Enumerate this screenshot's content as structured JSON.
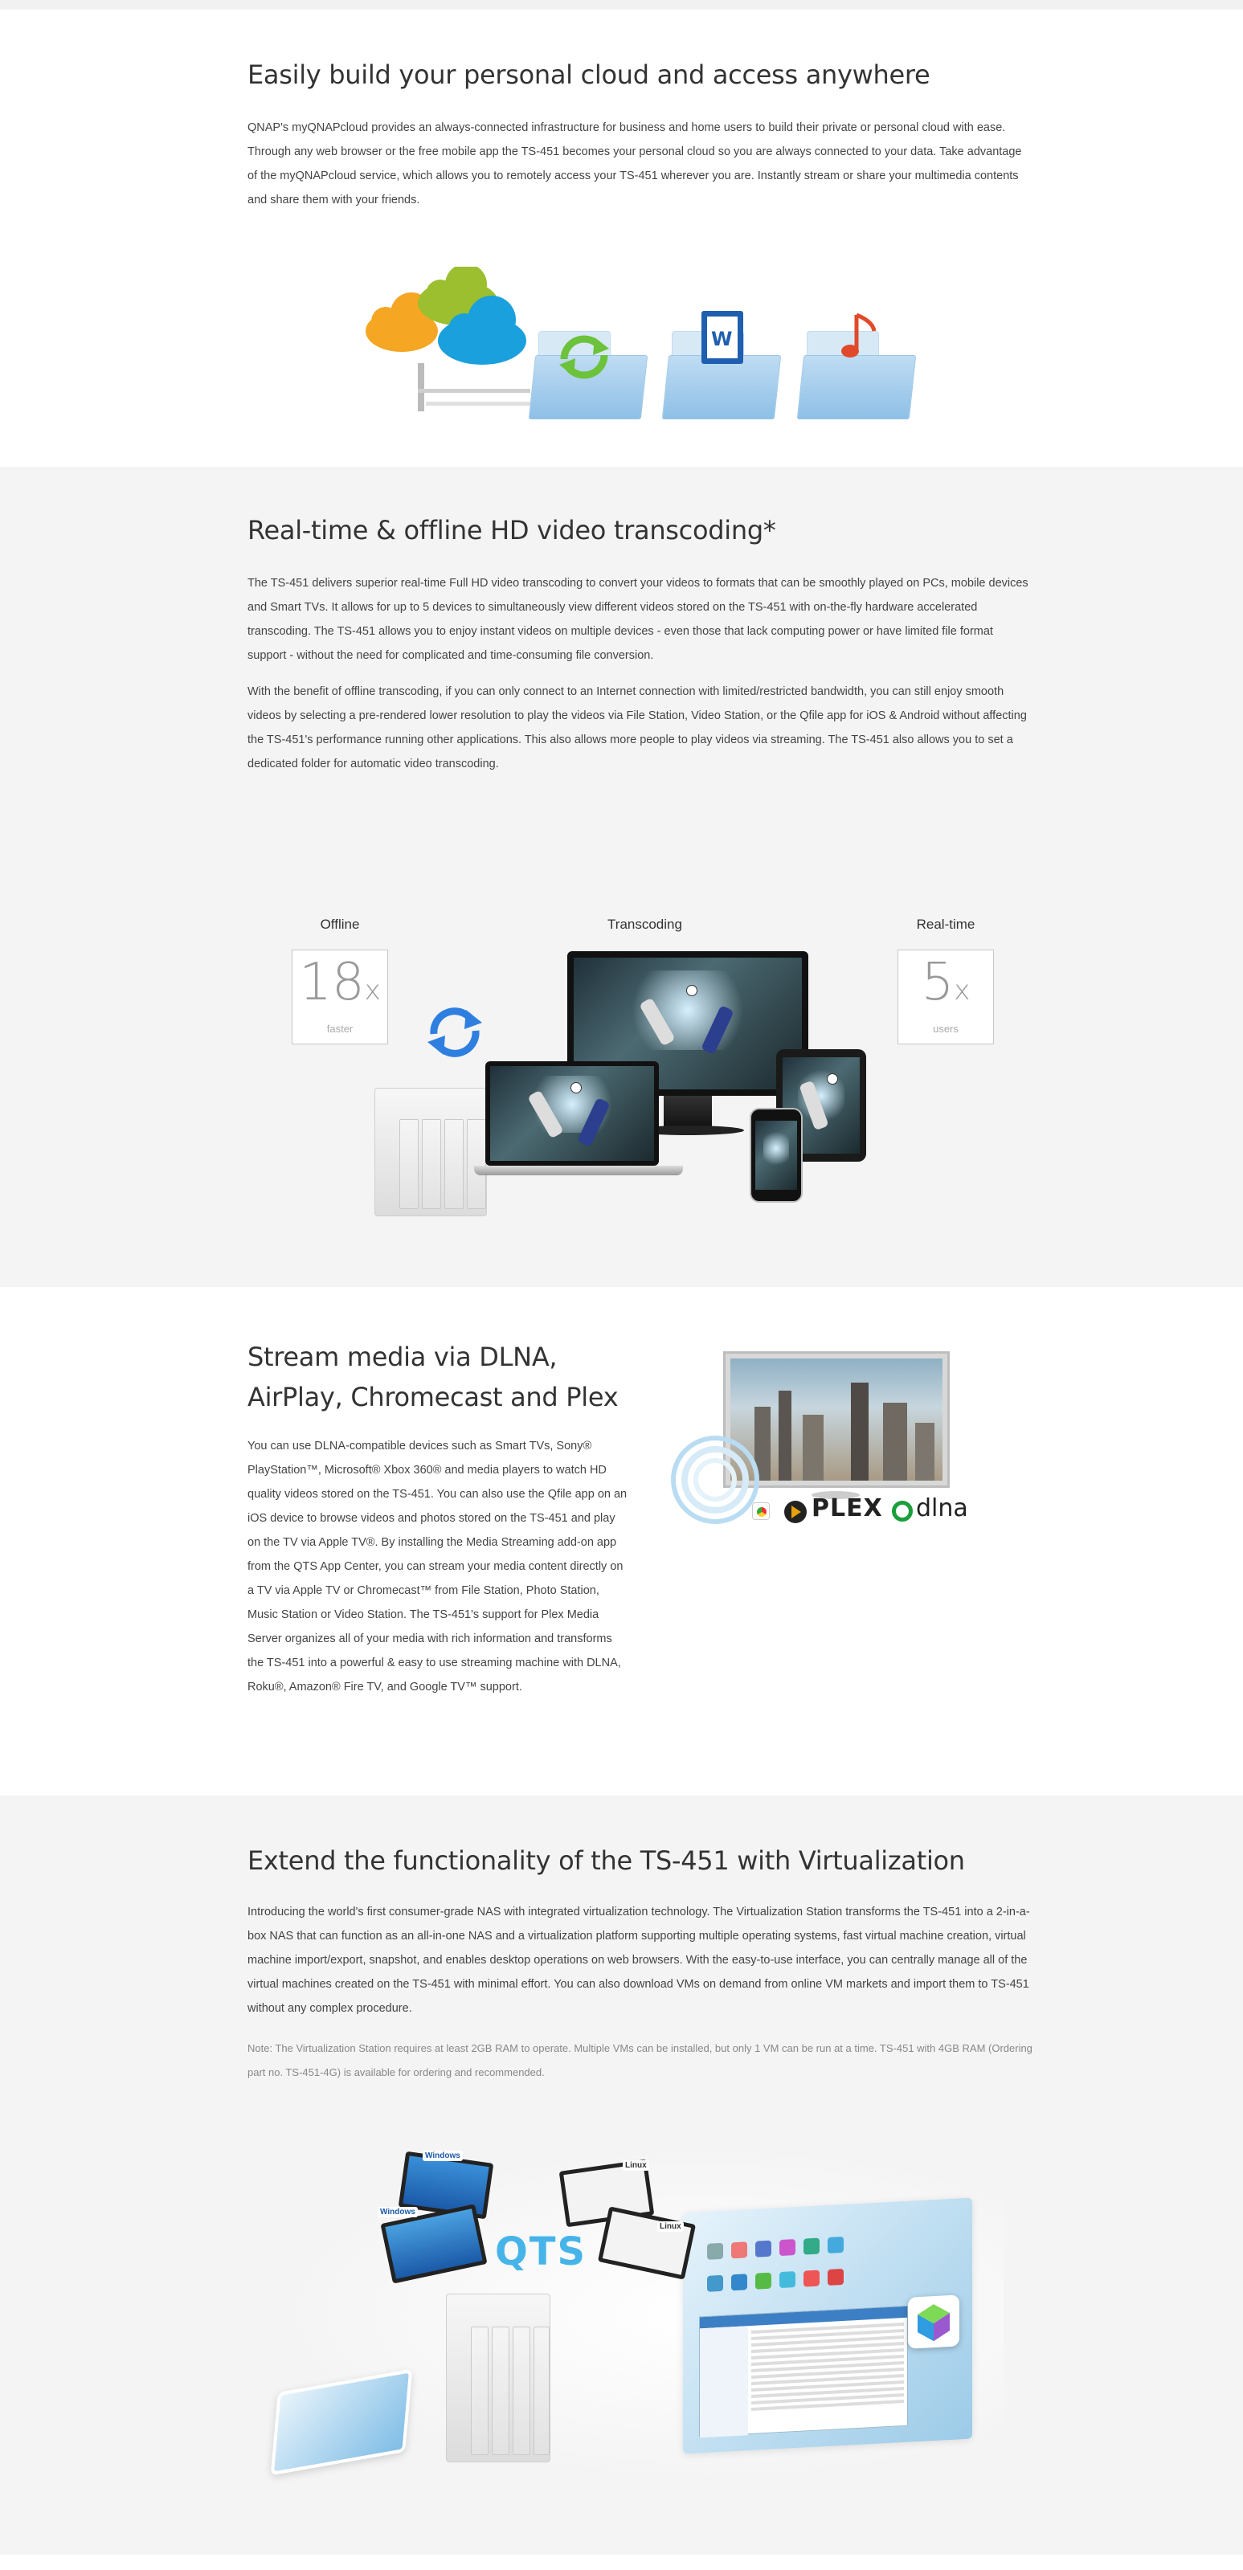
{
  "sections": {
    "cloud": {
      "title": "Easily build your personal cloud and access anywhere",
      "body": "QNAP's myQNAPcloud provides an always-connected infrastructure for business and home users to build their private or personal cloud with ease. Through any web browser or the free mobile app the TS-451 becomes your personal cloud so you are always connected to your data. Take advantage of the myQNAPcloud service, which allows you to remotely access your TS-451 wherever you are. Instantly stream or share your multimedia contents and share them with your friends."
    },
    "transcoding": {
      "title": "Real-time & offline HD video transcoding*",
      "body1": "The TS-451 delivers superior real-time Full HD video transcoding to convert your videos to formats that can be smoothly played on PCs, mobile devices and Smart TVs. It allows for up to 5 devices to simultaneously view different videos stored on the TS-451 with on-the-fly hardware accelerated transcoding. The TS-451 allows you to enjoy instant videos on multiple devices - even those that lack computing power or have limited file format support - without the need for complicated and time-consuming file conversion.",
      "body2": "With the benefit of offline transcoding, if you can only connect to an Internet connection with limited/restricted bandwidth, you can still enjoy smooth videos by selecting a pre-rendered lower resolution to play the videos via File Station, Video Station, or the Qfile app for iOS & Android without affecting the TS-451's performance running other applications. This also allows more people to play videos via streaming. The TS-451 also allows you to set a dedicated folder for automatic video transcoding.",
      "offline_label": "Offline",
      "offline_value": "18",
      "offline_unit": "x",
      "offline_sub": "faster",
      "transcoding_label": "Transcoding",
      "realtime_label": "Real-time",
      "realtime_value": "5",
      "realtime_unit": "x",
      "realtime_sub": "users"
    },
    "stream": {
      "title_line1": "Stream media via DLNA,",
      "title_line2": "AirPlay, Chromecast and Plex",
      "body": "You can use DLNA-compatible devices such as Smart TVs, Sony® PlayStation™, Microsoft® Xbox 360® and media players to watch HD quality videos stored on the TS-451. You can also use the Qfile app on an iOS device to browse videos and photos stored on the TS-451 and play on the TV via Apple TV®. By installing the Media Streaming add-on app from the QTS App Center, you can stream your media content directly on a TV via Apple TV or Chromecast™ from File Station, Photo Station, Music Station or Video Station. The TS-451's support for Plex Media Server organizes all of your media with rich information and transforms the TS-451 into a powerful & easy to use streaming machine with DLNA, Roku®, Amazon® Fire TV, and Google TV™ support.",
      "logo_plex": "PLEX",
      "logo_dlna": "dlna"
    },
    "virtualization": {
      "title": "Extend the functionality of the TS-451 with Virtualization",
      "body": "Introducing the world's first consumer-grade NAS with integrated virtualization technology. The Virtualization Station transforms the TS-451 into a 2-in-a-box NAS that can function as an all-in-one NAS and a virtualization platform supporting multiple operating systems, fast virtual machine creation, virtual machine import/export, snapshot, and enables desktop operations on web browsers. With the easy-to-use interface, you can centrally manage all of the virtual machines created on the TS-451 with minimal effort. You can also download VMs on demand from online VM markets and import them to TS-451 without any complex procedure.",
      "note": "Note: The Virtualization Station requires at least 2GB RAM to operate. Multiple VMs can be installed, but only 1 VM can be run at a time. TS-451 with 4GB RAM (Ordering part no. TS-451-4G) is available for ordering and recommended.",
      "qts_logo": "QTS",
      "os_windows": "Windows",
      "os_linux": "Linux"
    }
  },
  "colors": {
    "cloud_orange": "#f5a623",
    "cloud_green": "#9bbf2f",
    "cloud_blue": "#1aa0dc",
    "sync_blue": "#2f7fe0",
    "qts_blue": "#46b4e8",
    "plex_orange": "#e5a00d",
    "dlna_green": "#1b9e3b"
  },
  "icons": [
    "cloud-icon",
    "sync-icon",
    "document-icon",
    "music-icon",
    "refresh-icon",
    "airplay-icon"
  ]
}
